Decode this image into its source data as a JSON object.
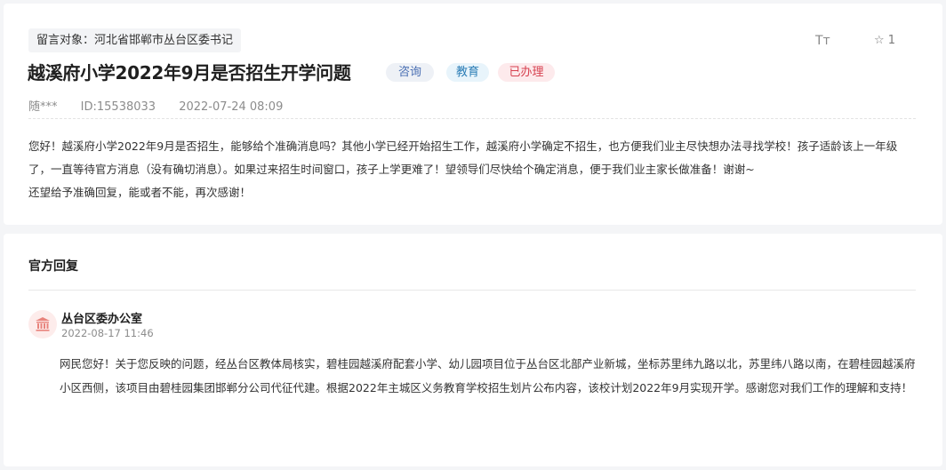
{
  "message": {
    "target_label": "留言对象：河北省邯郸市丛台区委书记",
    "title": "越溪府小学2022年9月是否招生开学问题",
    "tags": {
      "type": "咨询",
      "category": "教育",
      "status": "已办理"
    },
    "tools": {
      "font_size_icon": "Tт",
      "favorite_count": "1"
    },
    "author": "随***",
    "id_text": "ID:15538033",
    "datetime": "2022-07-24 08:09",
    "content_lines": [
      "您好！越溪府小学2022年9月是否招生，能够给个准确消息吗？其他小学已经开始招生工作，越溪府小学确定不招生，也方便我们业主尽快想办法寻找学校！孩子适龄该上一年级了，一直等待官方消息（没有确切消息）。如果过来招生时间窗口，孩子上学更难了！望领导们尽快给个确定消息，便于我们业主家长做准备！谢谢~",
      "还望给予准确回复，能或者不能，再次感谢！"
    ]
  },
  "reply": {
    "heading": "官方回复",
    "org_name": "丛台区委办公室",
    "datetime": "2022-08-17 11:46",
    "content": "网民您好！关于您反映的问题，经丛台区教体局核实，碧桂园越溪府配套小学、幼儿园项目位于丛台区北部产业新城，坐标苏里纬九路以北，苏里纬八路以南，在碧桂园越溪府小区西侧，该项目由碧桂园集团邯郸分公司代征代建。根据2022年主城区义务教育学校招生划片公布内容，该校计划2022年9月实现开学。感谢您对我们工作的理解和支持！"
  },
  "colors": {
    "status_red": "#d6404f",
    "tag_blue": "#4a6fb3",
    "edu_blue": "#2b7db6"
  }
}
